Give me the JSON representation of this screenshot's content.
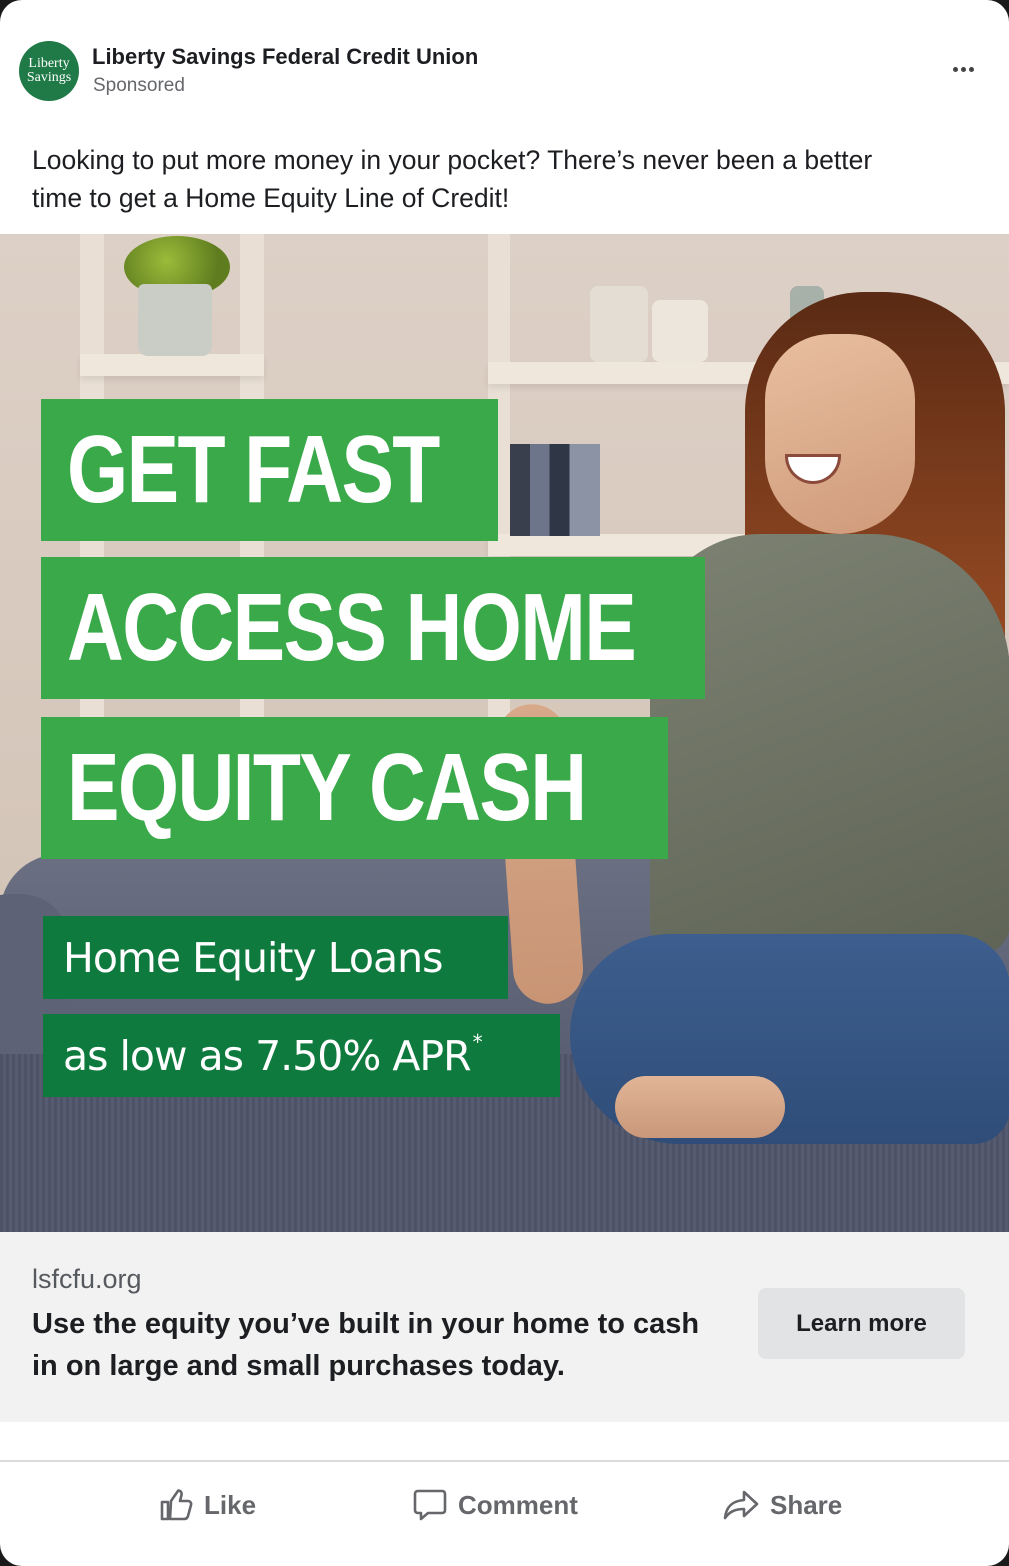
{
  "post": {
    "page_name": "Liberty Savings Federal Credit Union",
    "sponsored_label": "Sponsored",
    "avatar_text": [
      "Liberty",
      "Savings"
    ],
    "body_text": "Looking to put more money in your pocket? There’s never been a better time to get a Home Equity Line of Credit!"
  },
  "creative": {
    "headline_lines": [
      "GET FAST",
      "ACCESS HOME",
      "EQUITY CASH"
    ],
    "sub_line_1": "Home Equity Loans",
    "sub_line_2": "as low as 7.50% APR",
    "asterisk": "*",
    "colors": {
      "headline_green": "#3aa94a",
      "sub_green": "#0f7a3e"
    }
  },
  "link": {
    "domain": "lsfcfu.org",
    "headline": "Use the equity you’ve built in your home to cash in on large and small purchases today.",
    "cta_label": "Learn more"
  },
  "actions": {
    "like": "Like",
    "comment": "Comment",
    "share": "Share"
  },
  "icons": [
    "more-options-icon",
    "thumbs-up-icon",
    "comment-icon",
    "share-icon"
  ]
}
